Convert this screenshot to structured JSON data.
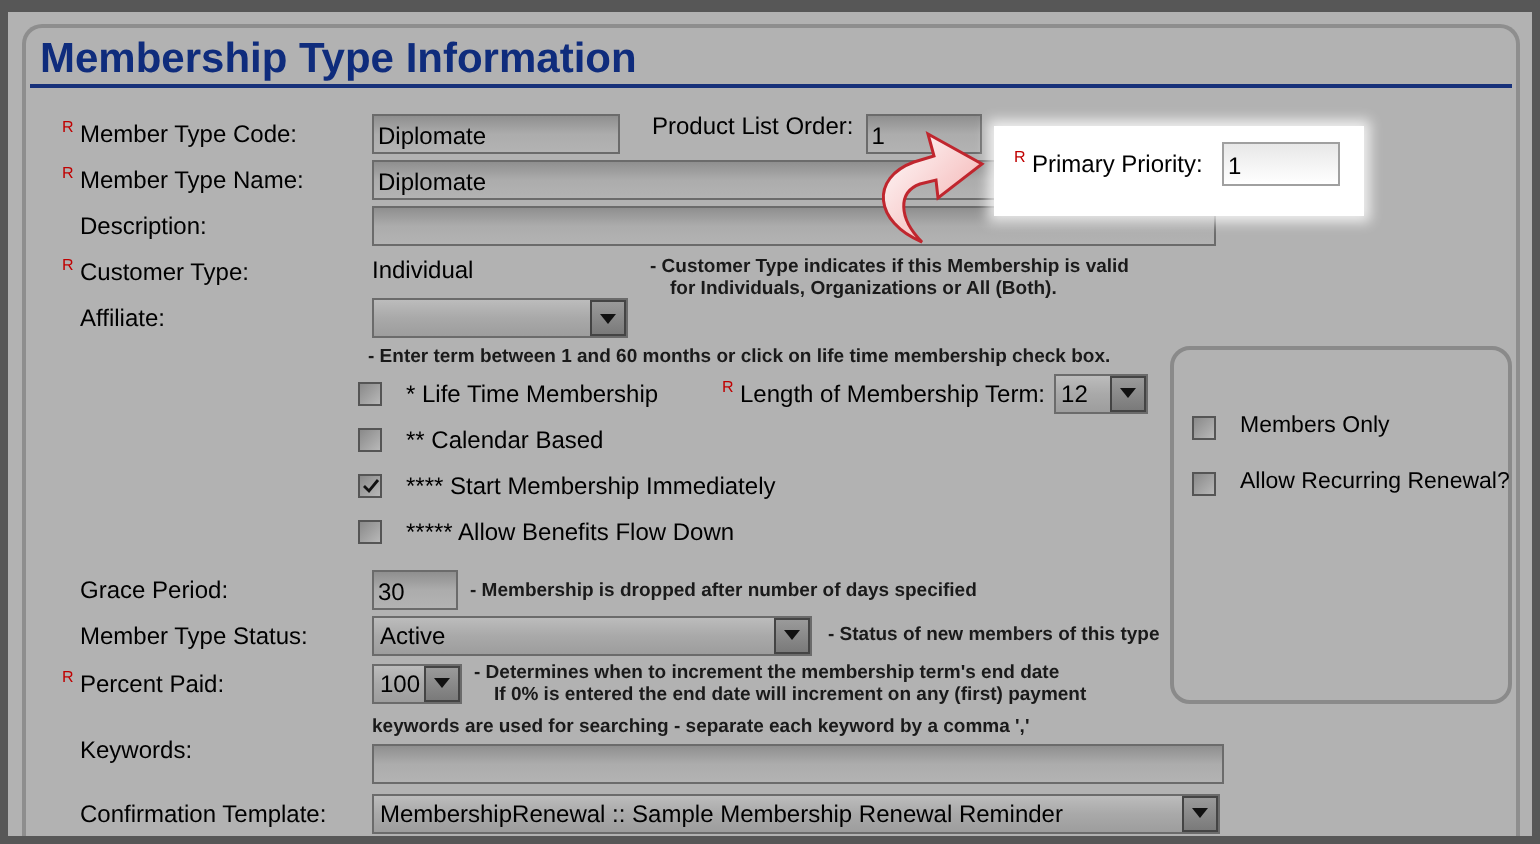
{
  "title": "Membership Type Information",
  "member_type_code": {
    "mark": "R",
    "label": "Member Type Code:",
    "value": "Diplomate"
  },
  "product_list_order": {
    "label": "Product List Order:",
    "value": "1"
  },
  "member_type_name": {
    "mark": "R",
    "label": "Member Type Name:",
    "value": "Diplomate"
  },
  "primary_priority": {
    "mark": "R",
    "label": "Primary Priority:",
    "value": "1"
  },
  "description": {
    "label": "Description:"
  },
  "customer_type": {
    "mark": "R",
    "label": "Customer Type:",
    "value": "Individual",
    "note": [
      "- Customer Type indicates if this Membership is valid",
      "for Individuals, Organizations or All (Both)."
    ]
  },
  "affiliate": {
    "label": "Affiliate:"
  },
  "term_note": "- Enter term between 1 and 60 months or click on life time membership check box.",
  "options": [
    {
      "label": "* Life Time Membership",
      "checked": false
    },
    {
      "label": "** Calendar Based",
      "checked": false
    },
    {
      "label": "**** Start Membership Immediately",
      "checked": true
    },
    {
      "label": "***** Allow Benefits Flow Down",
      "checked": false
    }
  ],
  "membership_term": {
    "mark": "R",
    "label": "Length of Membership Term:",
    "value": "12"
  },
  "side_options": [
    {
      "label": "Members Only",
      "checked": false
    },
    {
      "label": "Allow Recurring Renewal?",
      "checked": false
    }
  ],
  "grace_period": {
    "label": "Grace Period:",
    "value": "30",
    "note": "- Membership is dropped after number of days specified"
  },
  "member_type_status": {
    "label": "Member Type Status:",
    "value": "Active",
    "note": "- Status of new members of this type"
  },
  "percent_paid": {
    "mark": "R",
    "label": "Percent Paid:",
    "value": "100",
    "note": [
      "- Determines when to increment the membership term's end date",
      "If 0% is entered the end date will increment on any (first) payment"
    ]
  },
  "keywords": {
    "label": "Keywords:",
    "note": "keywords are used for searching - separate each keyword by a comma ','"
  },
  "confirmation_template": {
    "label": "Confirmation Template:",
    "value": "MembershipRenewal :: Sample Membership Renewal Reminder"
  }
}
